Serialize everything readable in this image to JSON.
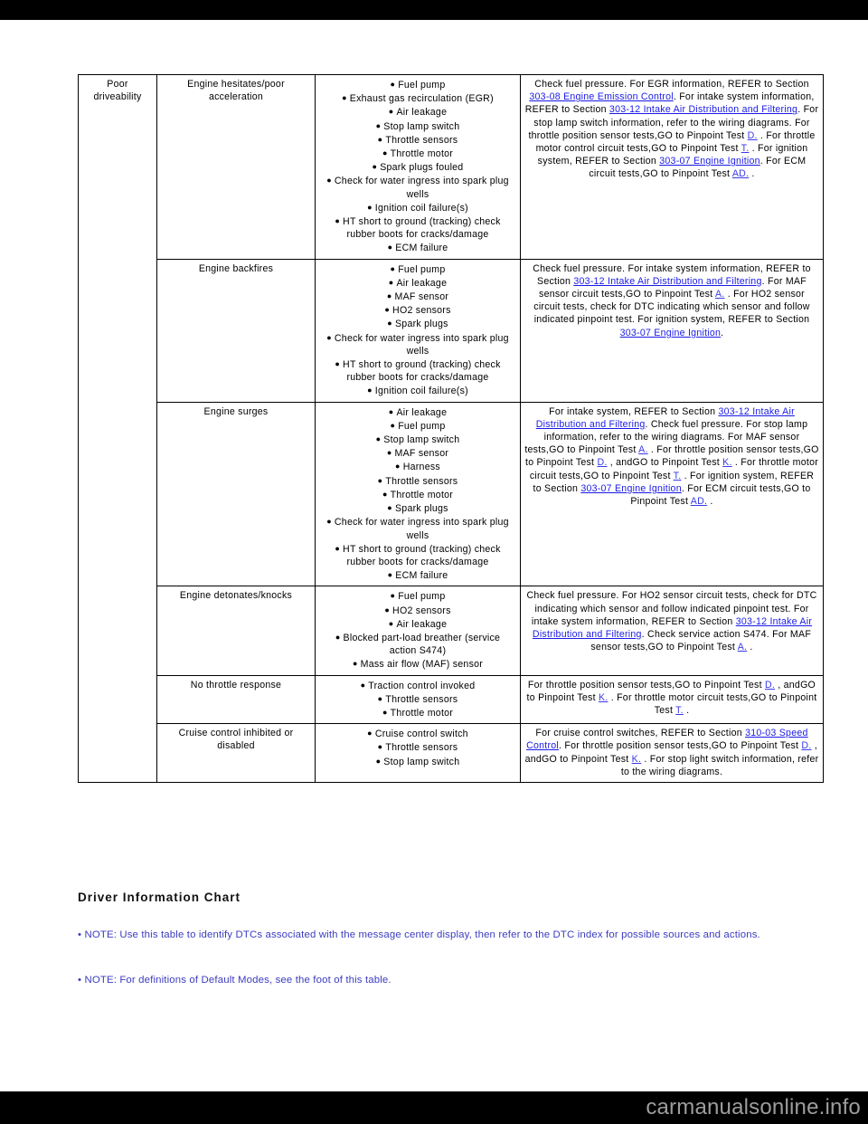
{
  "page": {
    "watermark": "carmanualsonline.info",
    "heading": "Driver Information Chart",
    "notes": [
      "• NOTE: Use this table to identify DTCs associated with the message center display, then refer to the DTC index for possible sources and actions.",
      "• NOTE: For definitions of Default Modes, see the foot of this table."
    ],
    "link_color": "#1a1ae6",
    "note_color": "#3c3cc0",
    "text_color": "#000000",
    "bar_color": "#000000",
    "watermark_color": "#9d9d9d"
  },
  "table": {
    "symptom": "Poor driveability",
    "rows": [
      {
        "condition": "Engine hesitates/poor acceleration",
        "sources": [
          "Fuel pump",
          "Exhaust gas recirculation (EGR)",
          "Air leakage",
          "Stop lamp switch",
          "Throttle sensors",
          "Throttle motor",
          "Spark plugs fouled",
          "Check for water ingress into spark plug wells",
          "Ignition coil failure(s)",
          "HT short to ground (tracking) check rubber boots for cracks/damage",
          "ECM failure"
        ],
        "action_parts": [
          {
            "t": "Check fuel pressure. For EGR information, REFER to Section "
          },
          {
            "t": "303-08 Engine Emission Control",
            "link": true
          },
          {
            "t": ". For intake system information, REFER to Section "
          },
          {
            "t": "303-12 Intake Air Distribution and Filtering",
            "link": true
          },
          {
            "t": ". For stop lamp switch information, refer to the wiring diagrams. For throttle position sensor tests,GO to Pinpoint Test "
          },
          {
            "t": "D.",
            "link": true
          },
          {
            "t": " . For throttle motor control circuit tests,GO to Pinpoint Test "
          },
          {
            "t": "T.",
            "link": true
          },
          {
            "t": " . For ignition system, REFER to Section "
          },
          {
            "t": "303-07 Engine Ignition",
            "link": true
          },
          {
            "t": ". For ECM circuit tests,GO to Pinpoint Test "
          },
          {
            "t": "AD.",
            "link": true
          },
          {
            "t": " ."
          }
        ]
      },
      {
        "condition": "Engine backfires",
        "sources": [
          "Fuel pump",
          "Air leakage",
          "MAF sensor",
          "HO2 sensors",
          "Spark plugs",
          "Check for water ingress into spark plug wells",
          "HT short to ground (tracking) check rubber boots for cracks/damage",
          "Ignition coil failure(s)"
        ],
        "action_parts": [
          {
            "t": "Check fuel pressure. For intake system information, REFER to Section "
          },
          {
            "t": "303-12 Intake Air Distribution and Filtering",
            "link": true
          },
          {
            "t": ". For MAF sensor circuit tests,GO to Pinpoint Test "
          },
          {
            "t": "A.",
            "link": true
          },
          {
            "t": " . For HO2 sensor circuit tests, check for DTC indicating which sensor and follow indicated pinpoint test. For ignition system, REFER to Section "
          },
          {
            "t": "303-07 Engine Ignition",
            "link": true
          },
          {
            "t": "."
          }
        ]
      },
      {
        "condition": "Engine surges",
        "sources": [
          "Air leakage",
          "Fuel pump",
          "Stop lamp switch",
          "MAF sensor",
          "Harness",
          "Throttle sensors",
          "Throttle motor",
          "Spark plugs",
          "Check for water ingress into spark plug wells",
          "HT short to ground (tracking) check rubber boots for cracks/damage",
          "ECM failure"
        ],
        "action_parts": [
          {
            "t": "For intake system, REFER to Section "
          },
          {
            "t": "303-12 Intake Air Distribution and Filtering",
            "link": true
          },
          {
            "t": ". Check fuel pressure. For stop lamp information, refer to the wiring diagrams. For MAF sensor tests,GO to Pinpoint Test "
          },
          {
            "t": "A.",
            "link": true
          },
          {
            "t": " . For throttle position sensor tests,GO to Pinpoint Test "
          },
          {
            "t": "D.",
            "link": true
          },
          {
            "t": " , andGO to Pinpoint Test "
          },
          {
            "t": "K.",
            "link": true
          },
          {
            "t": " . For throttle motor circuit tests,GO to Pinpoint Test "
          },
          {
            "t": "T.",
            "link": true
          },
          {
            "t": " . For ignition system, REFER to Section "
          },
          {
            "t": "303-07 Engine Ignition",
            "link": true
          },
          {
            "t": ". For ECM circuit tests,GO to Pinpoint Test "
          },
          {
            "t": "AD.",
            "link": true
          },
          {
            "t": " ."
          }
        ]
      },
      {
        "condition": "Engine detonates/knocks",
        "sources": [
          "Fuel pump",
          "HO2 sensors",
          "Air leakage",
          "Blocked part-load breather (service action S474)",
          "Mass air flow (MAF) sensor"
        ],
        "action_parts": [
          {
            "t": "Check fuel pressure. For HO2 sensor circuit tests, check for DTC indicating which sensor and follow indicated pinpoint test. For intake system information, REFER to Section "
          },
          {
            "t": "303-12 Intake Air Distribution and Filtering",
            "link": true
          },
          {
            "t": ". Check service action S474. For MAF sensor tests,GO to Pinpoint Test "
          },
          {
            "t": "A.",
            "link": true
          },
          {
            "t": " ."
          }
        ]
      },
      {
        "condition": "No throttle response",
        "sources": [
          "Traction control invoked",
          "Throttle sensors",
          "Throttle motor"
        ],
        "action_parts": [
          {
            "t": "For throttle position sensor tests,GO to Pinpoint Test "
          },
          {
            "t": "D.",
            "link": true
          },
          {
            "t": " , andGO to Pinpoint Test "
          },
          {
            "t": "K.",
            "link": true
          },
          {
            "t": " . For throttle motor circuit tests,GO to Pinpoint Test "
          },
          {
            "t": "T.",
            "link": true
          },
          {
            "t": " ."
          }
        ]
      },
      {
        "condition": "Cruise control inhibited or disabled",
        "sources": [
          "Cruise control switch",
          "Throttle sensors",
          "Stop lamp switch"
        ],
        "action_parts": [
          {
            "t": "For cruise control switches, REFER to Section "
          },
          {
            "t": "310-03 Speed Control",
            "link": true
          },
          {
            "t": ". For throttle position sensor tests,GO to Pinpoint Test "
          },
          {
            "t": "D.",
            "link": true
          },
          {
            "t": " , andGO to Pinpoint Test "
          },
          {
            "t": "K.",
            "link": true
          },
          {
            "t": " . For stop light switch information, refer to the wiring diagrams."
          }
        ]
      }
    ]
  }
}
